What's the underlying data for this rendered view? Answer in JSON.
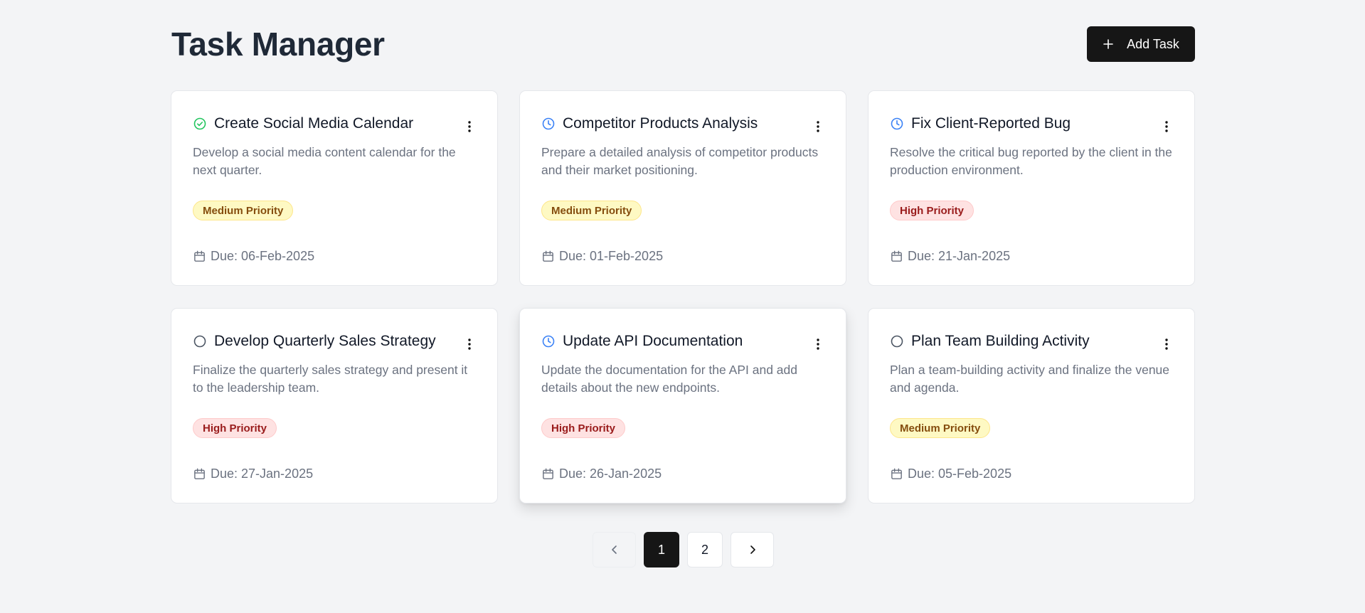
{
  "header": {
    "title": "Task Manager",
    "add_button_label": "Add Task"
  },
  "colors": {
    "done": "#22c55e",
    "in_progress": "#3b82f6",
    "todo": "#4b5563",
    "primary_button": "#161616"
  },
  "tasks": [
    {
      "status": "completed",
      "status_icon": "check-circle-icon",
      "title": "Create Social Media Calendar",
      "description": "Develop a social media content calendar for the next quarter.",
      "priority": "Medium Priority",
      "due": "Due: 06-Feb-2025"
    },
    {
      "status": "in-progress",
      "status_icon": "clock-icon",
      "title": "Competitor Products Analysis",
      "description": "Prepare a detailed analysis of competitor products and their market positioning.",
      "priority": "Medium Priority",
      "due": "Due: 01-Feb-2025"
    },
    {
      "status": "in-progress",
      "status_icon": "clock-icon",
      "title": "Fix Client-Reported Bug",
      "description": "Resolve the critical bug reported by the client in the production environment.",
      "priority": "High Priority",
      "due": "Due: 21-Jan-2025"
    },
    {
      "status": "pending",
      "status_icon": "circle-icon",
      "title": "Develop Quarterly Sales Strategy",
      "description": "Finalize the quarterly sales strategy and present it to the leadership team.",
      "priority": "High Priority",
      "due": "Due: 27-Jan-2025"
    },
    {
      "status": "in-progress",
      "status_icon": "clock-icon",
      "title": "Update API Documentation",
      "description": "Update the documentation for the API and add details about the new endpoints.",
      "priority": "High Priority",
      "due": "Due: 26-Jan-2025"
    },
    {
      "status": "pending",
      "status_icon": "circle-icon",
      "title": "Plan Team Building Activity",
      "description": "Plan a team-building activity and finalize the venue and agenda.",
      "priority": "Medium Priority",
      "due": "Due: 05-Feb-2025"
    }
  ],
  "pagination": {
    "pages": [
      "1",
      "2"
    ],
    "current": "1",
    "prev_icon": "chevron-left-icon",
    "next_icon": "chevron-right-icon"
  }
}
